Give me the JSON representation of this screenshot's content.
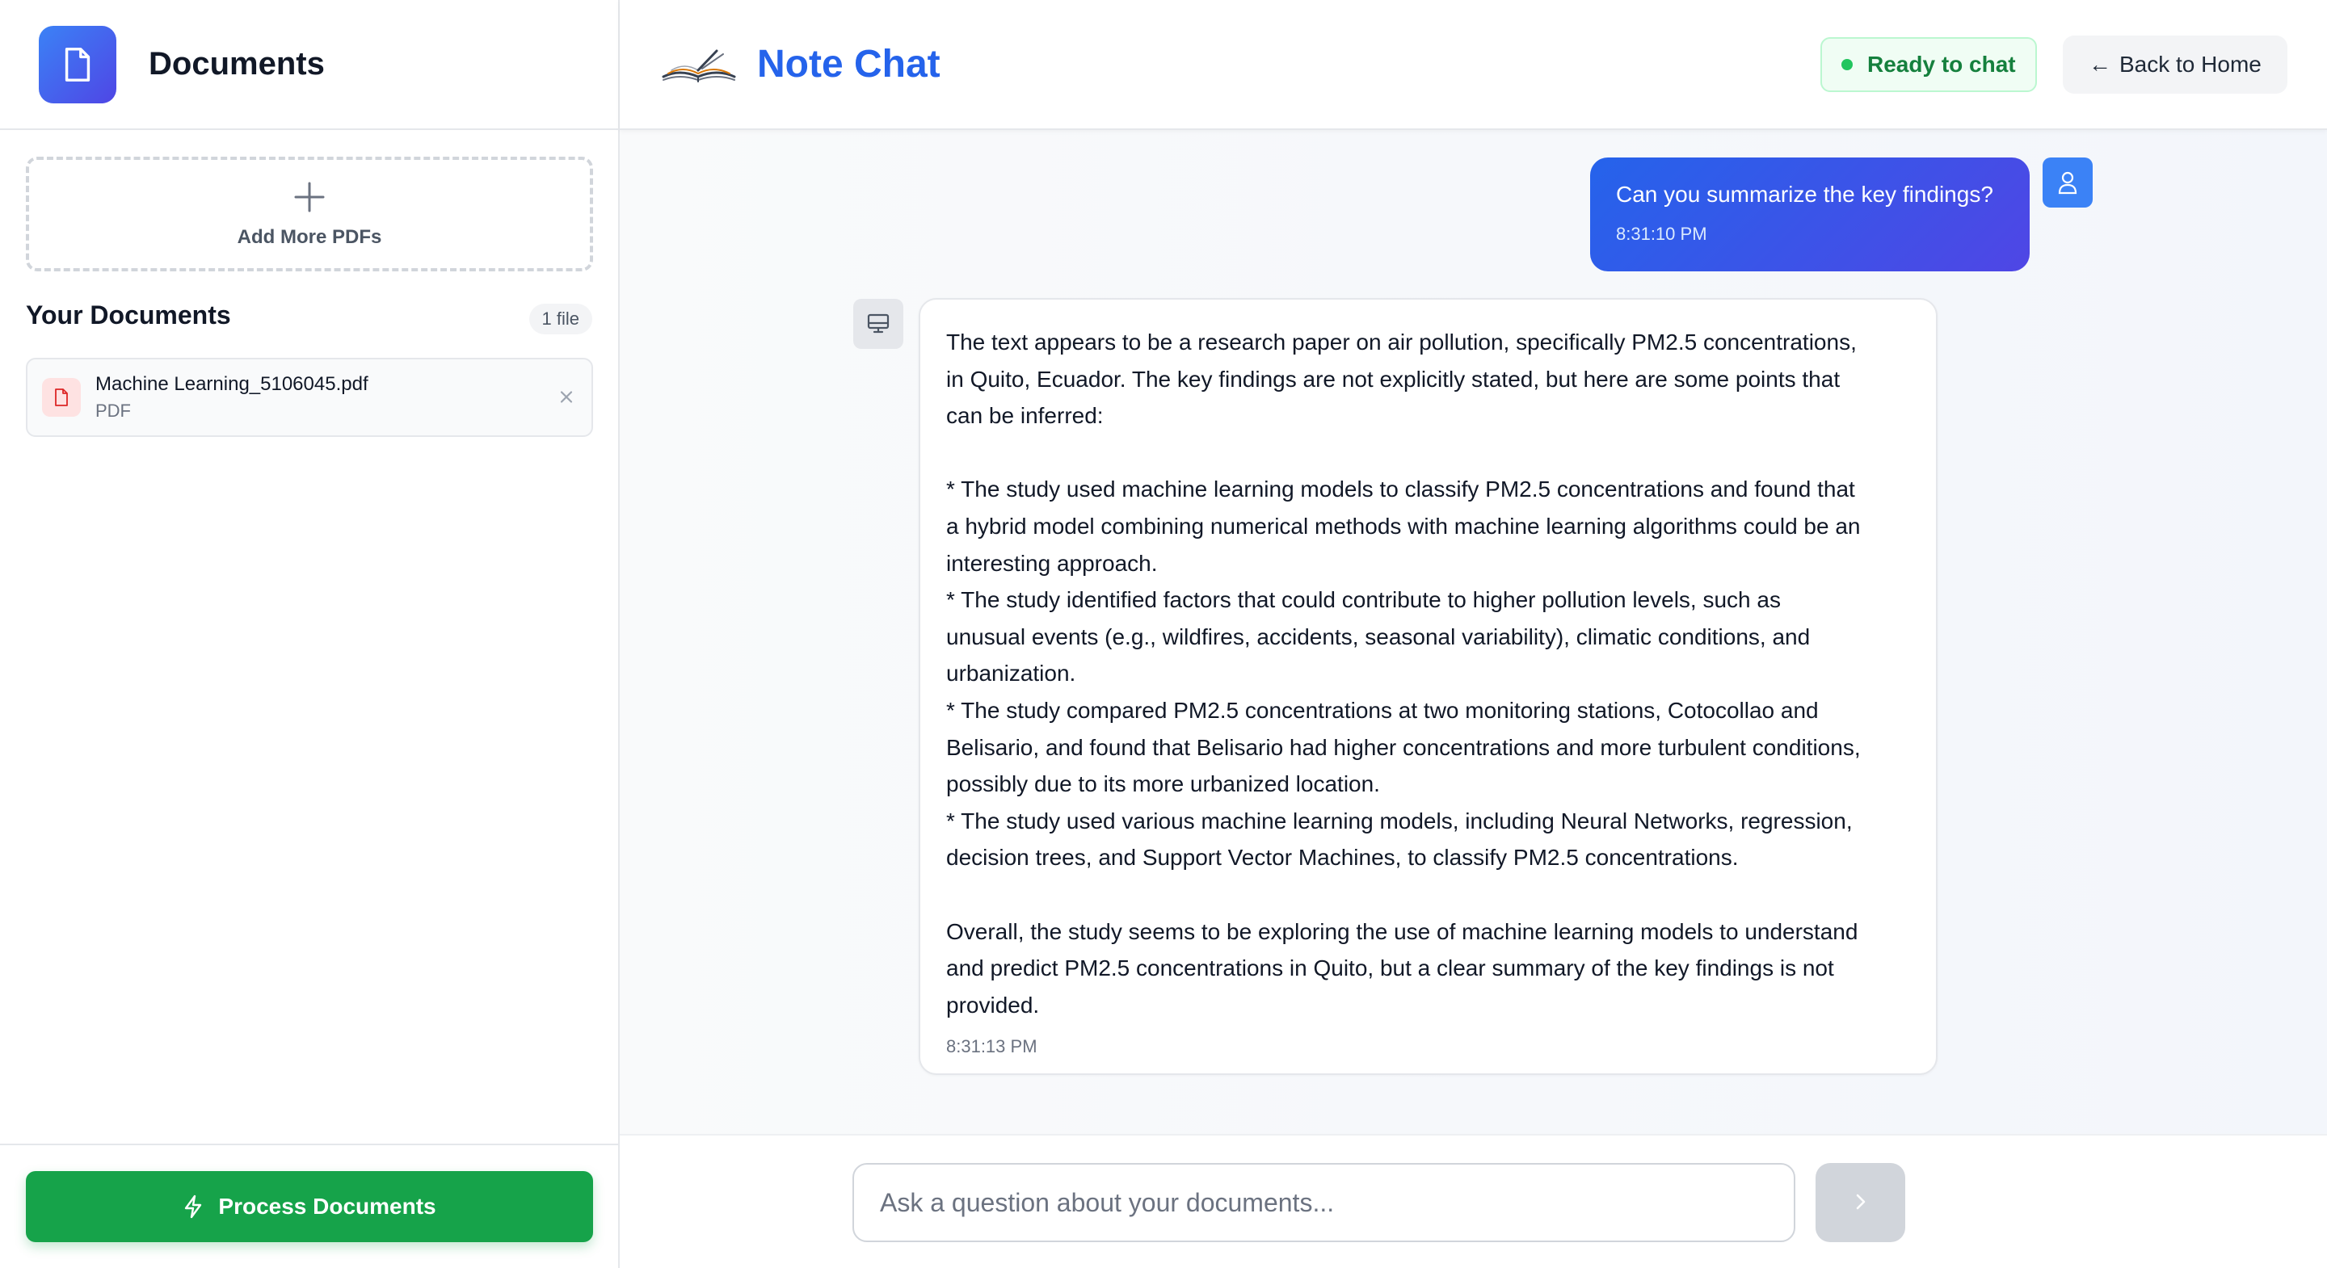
{
  "sidebar": {
    "title": "Documents",
    "logo_icon": "file-icon",
    "upload": {
      "label": "Add More PDFs",
      "icon": "plus-icon"
    },
    "documents_heading": "Your Documents",
    "documents_count": "1 file",
    "files": [
      {
        "name": "Machine Learning_5106045.pdf",
        "type": "PDF",
        "icon": "pdf-file-icon",
        "remove_icon": "close-icon"
      }
    ],
    "process_button": {
      "label": "Process Documents",
      "icon": "lightning-icon"
    }
  },
  "header": {
    "title": "Note Chat",
    "logo_icon": "open-book-icon",
    "status": {
      "label": "Ready to chat",
      "color": "#22c55e"
    },
    "back_button": {
      "label": "Back to Home",
      "arrow": "←"
    }
  },
  "messages": [
    {
      "role": "user",
      "text": "Can you summarize the key findings?",
      "time": "8:31:10 PM",
      "avatar_icon": "user-icon"
    },
    {
      "role": "assistant",
      "text": "The text appears to be a research paper on air pollution, specifically PM2.5 concentrations,\nin Quito, Ecuador. The key findings are not explicitly stated, but here are some points that\ncan be inferred:\n\n* The study used machine learning models to classify PM2.5 concentrations and found that\na hybrid model combining numerical methods with machine learning algorithms could be an\ninteresting approach.\n* The study identified factors that could contribute to higher pollution levels, such as\nunusual events (e.g., wildfires, accidents, seasonal variability), climatic conditions, and\nurbanization.\n* The study compared PM2.5 concentrations at two monitoring stations, Cotocollao and\nBelisario, and found that Belisario had higher concentrations and more turbulent conditions,\npossibly due to its more urbanized location.\n* The study used various machine learning models, including Neural Networks, regression,\ndecision trees, and Support Vector Machines, to classify PM2.5 concentrations.\n\nOverall, the study seems to be exploring the use of machine learning models to understand\nand predict PM2.5 concentrations in Quito, but a clear summary of the key findings is not\nprovided.",
      "time": "8:31:13 PM",
      "avatar_icon": "bot-icon"
    }
  ],
  "composer": {
    "value": "",
    "placeholder": "Ask a question about your documents...",
    "send_icon": "chevron-right-icon"
  },
  "colors": {
    "brand_blue": "#2563eb",
    "accent_indigo": "#4f46e5",
    "process_green": "#16a34a",
    "status_green": "#15803d",
    "file_icon_red": "#dc2626"
  }
}
